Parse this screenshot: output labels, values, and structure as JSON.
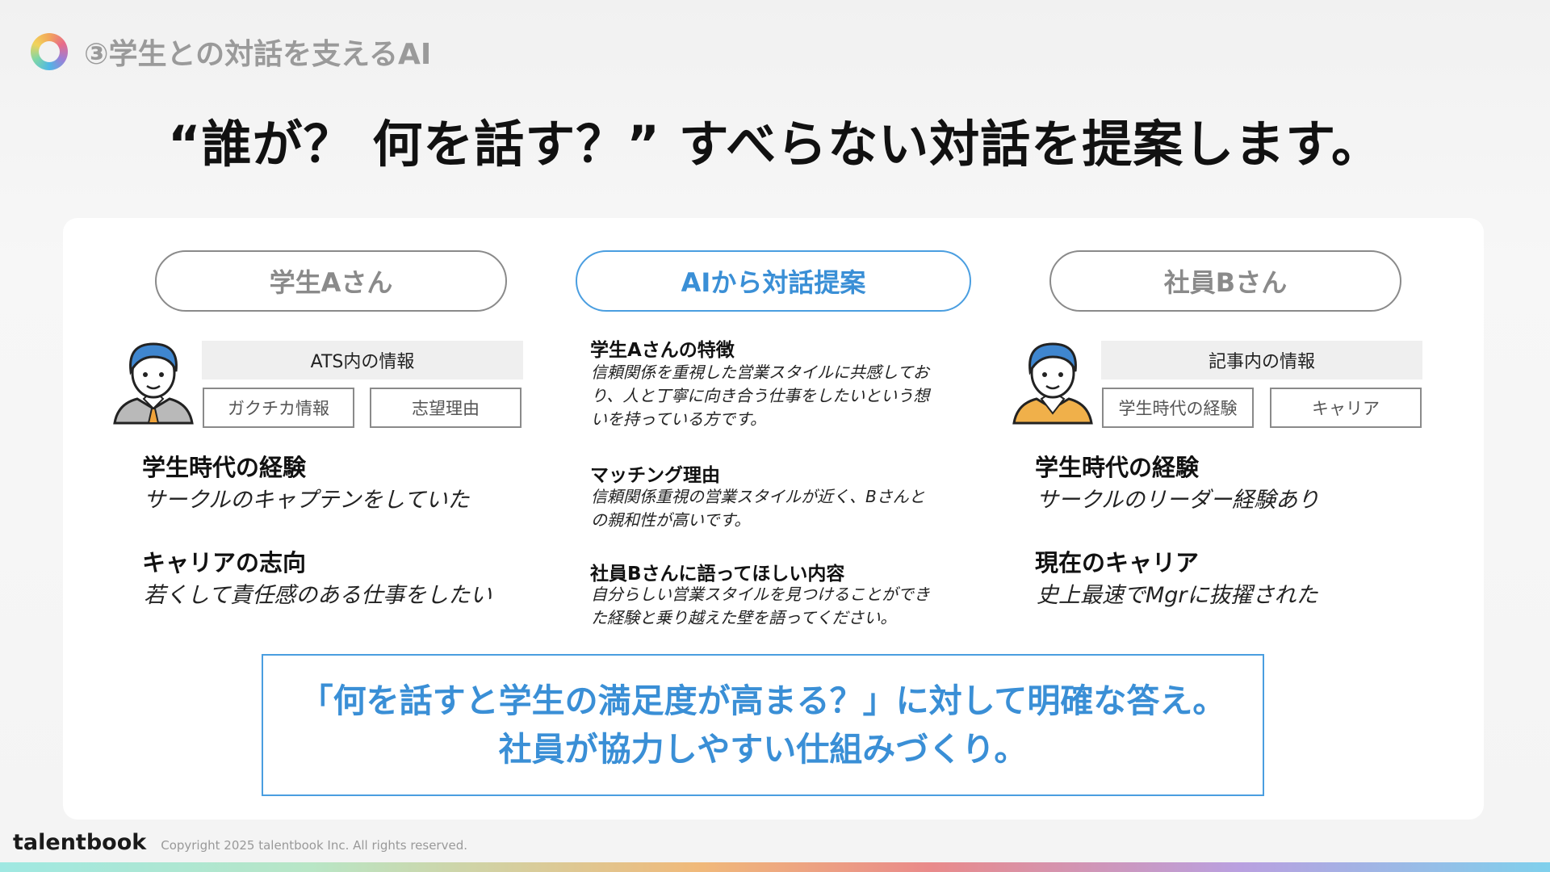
{
  "header": {
    "section_title": "③学生との対話を支えるAI"
  },
  "headline": "“誰が？ 何を話す？” すべらない対話を提案します。",
  "student": {
    "pill": "学生Aさん",
    "info_title": "ATS内の情報",
    "tags": [
      "ガクチカ情報",
      "志望理由"
    ],
    "items": [
      {
        "label": "学生時代の経験",
        "value": "サークルのキャプテンをしていた"
      },
      {
        "label": "キャリアの志向",
        "value": "若くして責任感のある仕事をしたい"
      }
    ]
  },
  "ai": {
    "pill": "AIから対話提案",
    "sections": [
      {
        "label": "学生Aさんの特徴",
        "lines": [
          "信頼関係を重視した営業スタイルに共感してお",
          "り、人と丁寧に向き合う仕事をしたいという想",
          "いを持っている方です。"
        ]
      },
      {
        "label": "マッチング理由",
        "lines": [
          "信頼関係重視の営業スタイルが近く、Bさんと",
          "の親和性が高いです。"
        ]
      },
      {
        "label": "社員Bさんに語ってほしい内容",
        "lines": [
          "自分らしい営業スタイルを見つけることができ",
          "た経験と乗り越えた壁を語ってください。"
        ]
      }
    ]
  },
  "employee": {
    "pill": "社員Bさん",
    "info_title": "記事内の情報",
    "tags": [
      "学生時代の経験",
      "キャリア"
    ],
    "items": [
      {
        "label": "学生時代の経験",
        "value": "サークルのリーダー経験あり"
      },
      {
        "label": "現在のキャリア",
        "value": "史上最速でMgrに抜擢された"
      }
    ]
  },
  "callout": {
    "line1": "「何を話すと学生の満足度が高まる？」に対して明確な答え。",
    "line2": "社員が協力しやすい仕組みづくり。"
  },
  "footer": {
    "brand": "talentbook",
    "copyright": "Copyright 2025 talentbook Inc. All rights reserved."
  },
  "colors": {
    "accent_blue": "#3a8fd6",
    "muted_gray": "#8a8a8a"
  },
  "icons": [
    "logo-ring-icon",
    "student-avatar-icon",
    "employee-avatar-icon"
  ]
}
